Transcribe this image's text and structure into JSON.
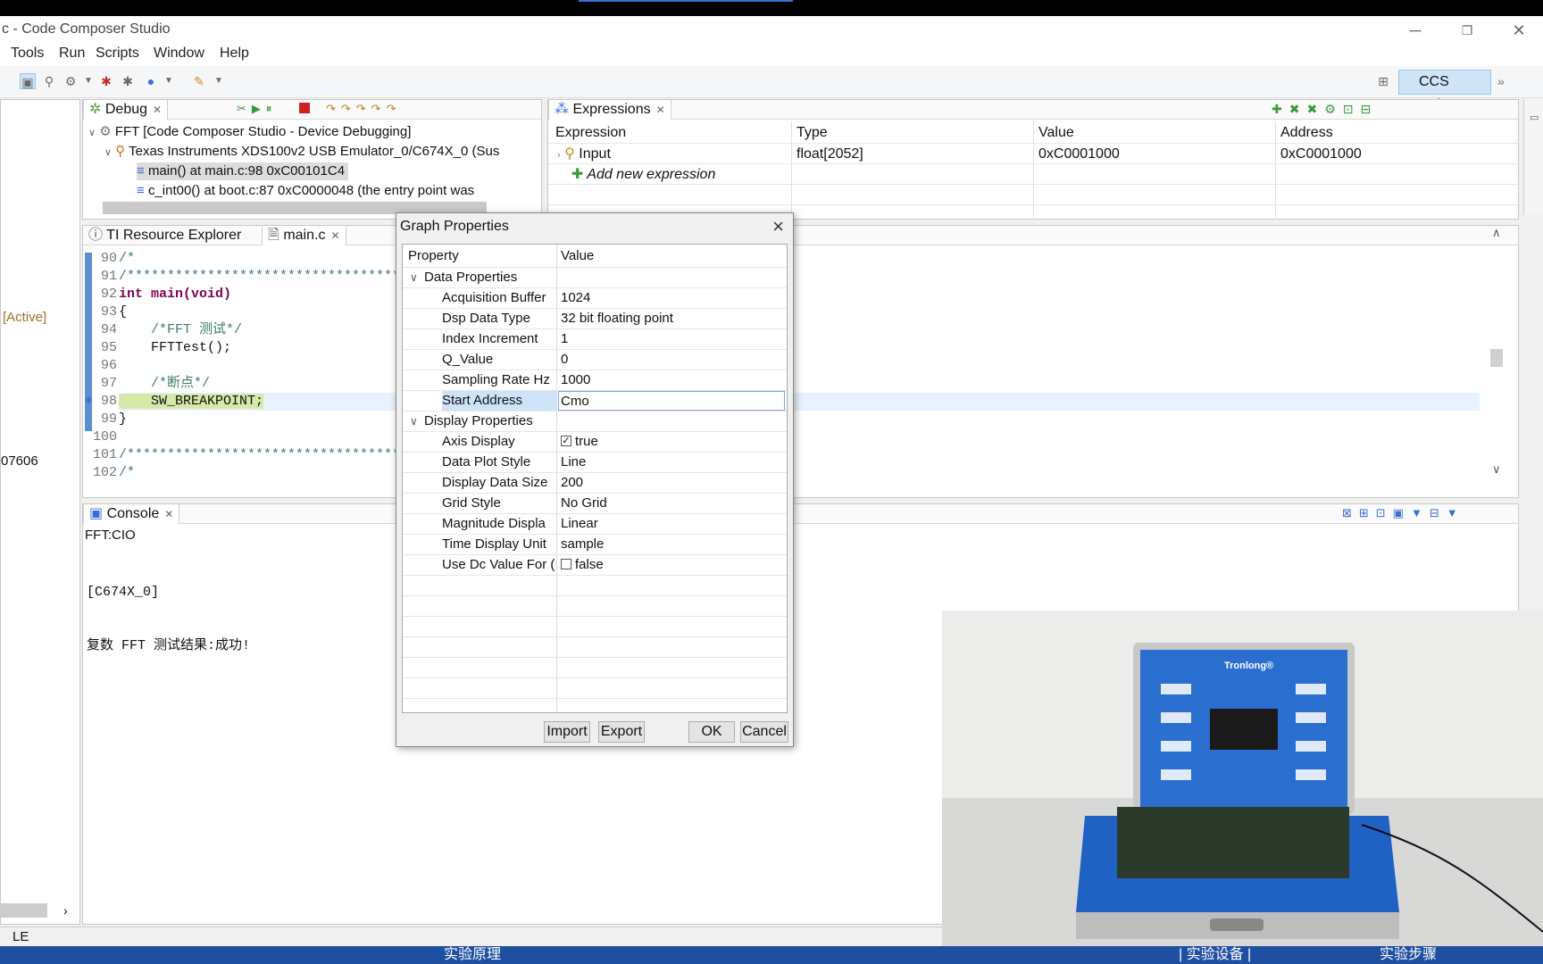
{
  "window": {
    "title": "c - Code Composer Studio"
  },
  "menu": [
    "Tools",
    "Run",
    "Scripts",
    "Window",
    "Help"
  ],
  "perspective": {
    "label": "CCS Deb..."
  },
  "left_panel": {
    "active_label": "[Active]",
    "fragment": "07606",
    "status": "LE"
  },
  "debug": {
    "tab": "Debug",
    "rows": [
      "FFT [Code Composer Studio - Device Debugging]",
      "Texas Instruments XDS100v2 USB Emulator_0/C674X_0 (Sus",
      "main() at main.c:98 0xC00101C4",
      "c_int00() at boot.c:87 0xC0000048  (the entry point was"
    ]
  },
  "expressions": {
    "tab": "Expressions",
    "headers": [
      "Expression",
      "Type",
      "Value",
      "Address"
    ],
    "rows": [
      {
        "expression": "Input",
        "type": "float[2052]",
        "value": "0xC0001000",
        "address": "0xC0001000"
      }
    ],
    "add_label": "Add new expression"
  },
  "editor": {
    "tabs": [
      "TI Resource Explorer",
      "main.c"
    ],
    "lines": [
      {
        "n": "90",
        "text": "/*"
      },
      {
        "n": "91",
        "text": "/*****************************************"
      },
      {
        "n": "92",
        "text": "int main(void)"
      },
      {
        "n": "93",
        "text": "{"
      },
      {
        "n": "94",
        "text": "    /*FFT 测试*/"
      },
      {
        "n": "95",
        "text": "    FFTTest();"
      },
      {
        "n": "96",
        "text": ""
      },
      {
        "n": "97",
        "text": "    /*断点*/"
      },
      {
        "n": "98",
        "text": "    SW_BREAKPOINT;"
      },
      {
        "n": "99",
        "text": "}"
      },
      {
        "n": "100",
        "text": ""
      },
      {
        "n": "101",
        "text": "/*****************************************"
      },
      {
        "n": "102",
        "text": "/*"
      }
    ]
  },
  "console": {
    "tab": "Console",
    "name": "FFT:CIO",
    "lines": [
      "[C674X_0]",
      "复数 FFT 测试结果:成功!"
    ]
  },
  "dialog": {
    "title": "Graph Properties",
    "col_property": "Property",
    "col_value": "Value",
    "groups": [
      {
        "name": "Data Properties",
        "rows": [
          {
            "k": "Acquisition Buffer",
            "v": "1024"
          },
          {
            "k": "Dsp Data Type",
            "v": "32 bit floating point"
          },
          {
            "k": "Index Increment",
            "v": "1"
          },
          {
            "k": "Q_Value",
            "v": "0"
          },
          {
            "k": "Sampling Rate Hz",
            "v": "1000"
          },
          {
            "k": "Start Address",
            "v": "Cmo"
          }
        ]
      },
      {
        "name": "Display Properties",
        "rows": [
          {
            "k": "Axis Display",
            "v": "true",
            "checkbox": true
          },
          {
            "k": "Data Plot Style",
            "v": "Line"
          },
          {
            "k": "Display Data Size",
            "v": "200"
          },
          {
            "k": "Grid Style",
            "v": "No Grid"
          },
          {
            "k": "Magnitude Displa",
            "v": "Linear"
          },
          {
            "k": "Time Display Unit",
            "v": "sample"
          },
          {
            "k": "Use Dc Value For (",
            "v": "false",
            "checkbox": false
          }
        ]
      }
    ],
    "buttons": {
      "import": "Import",
      "export": "Export",
      "ok": "OK",
      "cancel": "Cancel"
    }
  },
  "video": {
    "brand": "Tronlong®"
  },
  "bottom_bar": [
    "实验原理",
    "| 实验设备 |",
    "实验步骤"
  ]
}
